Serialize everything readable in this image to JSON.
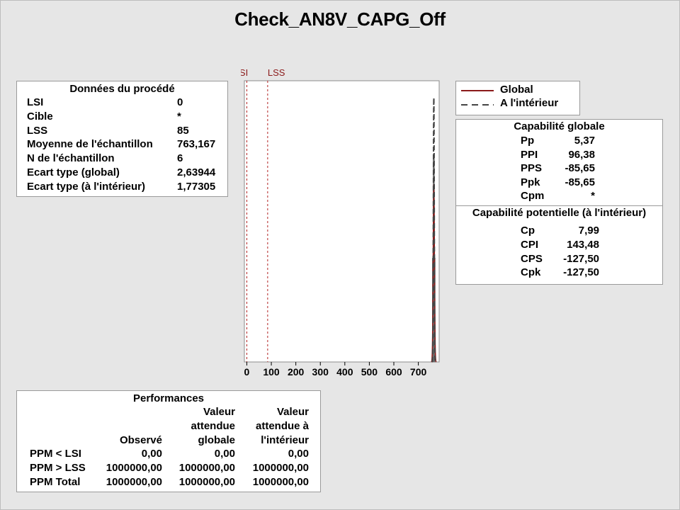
{
  "title": "Check_AN8V_CAPG_Off",
  "process_data": {
    "header": "Données du procédé",
    "rows": [
      {
        "label": "LSI",
        "value": "0"
      },
      {
        "label": "Cible",
        "value": "*"
      },
      {
        "label": "LSS",
        "value": "85"
      },
      {
        "label": "Moyenne de l'échantillon",
        "value": "763,167"
      },
      {
        "label": "N de l'échantillon",
        "value": "6"
      },
      {
        "label": "Ecart type (global)",
        "value": "2,63944"
      },
      {
        "label": "Ecart type (à l'intérieur)",
        "value": "1,77305"
      }
    ]
  },
  "legend": {
    "global": "Global",
    "within": "A l'intérieur"
  },
  "overall_capability": {
    "header": "Capabilité globale",
    "rows": [
      {
        "label": "Pp",
        "value": "5,37"
      },
      {
        "label": "PPI",
        "value": "96,38"
      },
      {
        "label": "PPS",
        "value": "-85,65"
      },
      {
        "label": "Ppk",
        "value": "-85,65"
      },
      {
        "label": "Cpm",
        "value": "*"
      }
    ]
  },
  "potential_capability": {
    "header": "Capabilité potentielle (à l'intérieur)",
    "rows": [
      {
        "label": "Cp",
        "value": "7,99"
      },
      {
        "label": "CPI",
        "value": "143,48"
      },
      {
        "label": "CPS",
        "value": "-127,50"
      },
      {
        "label": "Cpk",
        "value": "-127,50"
      }
    ]
  },
  "performance": {
    "header": "Performances",
    "col_headers": [
      [
        "",
        "",
        "Observé"
      ],
      [
        "Valeur",
        "attendue",
        "globale"
      ],
      [
        "Valeur",
        "attendue à",
        "l'intérieur"
      ]
    ],
    "rows": [
      {
        "label": "PPM < LSI",
        "values": [
          "0,00",
          "0,00",
          "0,00"
        ]
      },
      {
        "label": "PPM > LSS",
        "values": [
          "1000000,00",
          "1000000,00",
          "1000000,00"
        ]
      },
      {
        "label": "PPM Total",
        "values": [
          "1000000,00",
          "1000000,00",
          "1000000,00"
        ]
      }
    ]
  },
  "chart_data": {
    "type": "histogram",
    "xlim": [
      -10,
      785
    ],
    "ticks": [
      0,
      100,
      200,
      300,
      400,
      500,
      600,
      700
    ],
    "tick_labels": [
      "0",
      "100",
      "200",
      "300",
      "400",
      "500",
      "600",
      "700"
    ],
    "spec_limits": [
      {
        "name": "LSI",
        "value": 0
      },
      {
        "name": "LSS",
        "value": 85
      }
    ],
    "histogram": {
      "bins": [
        {
          "start": 757,
          "end": 760,
          "count": 1
        },
        {
          "start": 760,
          "end": 763,
          "count": 2
        },
        {
          "start": 763,
          "end": 766,
          "count": 2
        },
        {
          "start": 766,
          "end": 769,
          "count": 1
        }
      ],
      "ymax": 2.4
    },
    "curves": [
      {
        "name": "Global",
        "mean": 763.167,
        "sd": 2.63944,
        "style": "solid",
        "color": "#8b1a1a"
      },
      {
        "name": "A l'intérieur",
        "mean": 763.167,
        "sd": 1.77305,
        "style": "dashed",
        "color": "#444444"
      }
    ],
    "colors": {
      "spec": "#b22222",
      "global": "#8b1a1a",
      "within": "#444444"
    }
  }
}
